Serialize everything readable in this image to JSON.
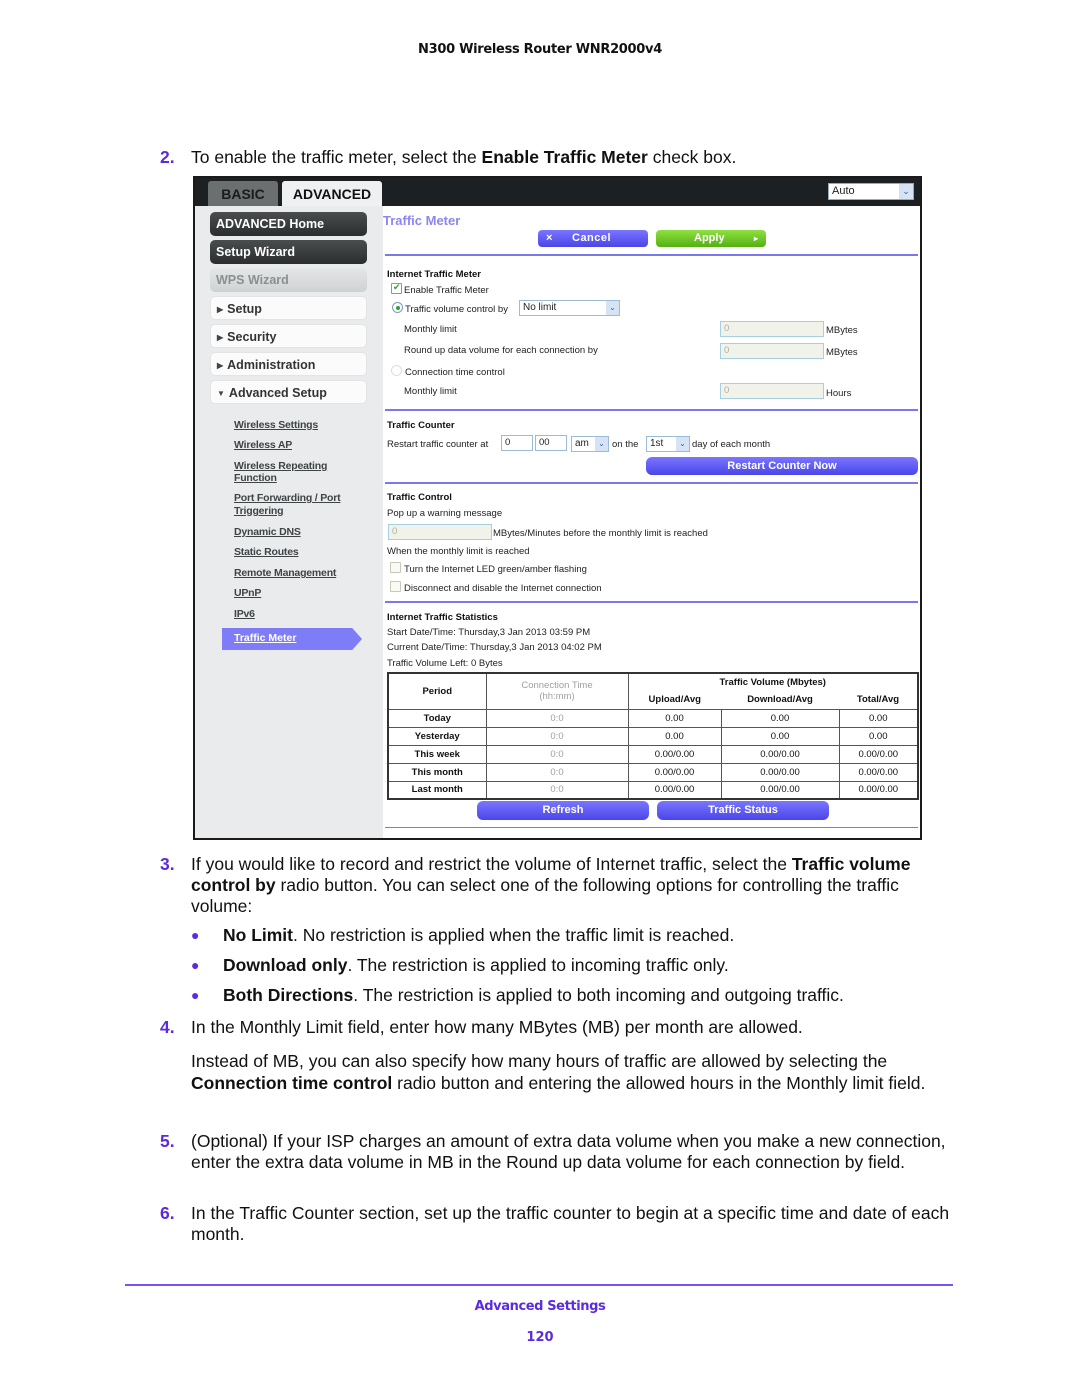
{
  "document": {
    "header": "N300 Wireless Router WNR2000v4",
    "footer_section": "Advanced Settings",
    "page_number": "120",
    "accent_color": "#5b2be0"
  },
  "steps": {
    "s2": {
      "num": "2.",
      "pre": "To enable the traffic meter, select the ",
      "bold": "Enable Traffic Meter",
      "post": " check box."
    },
    "s3": {
      "num": "3.",
      "pre": "If you would like to record and restrict the volume of Internet traffic, select the ",
      "bold": "Traffic volume control by",
      "post": " radio button. You can select one of the following options for controlling the traffic volume:"
    },
    "bullets": [
      {
        "bold": "No Limit",
        "text": ". No restriction is applied when the traffic limit is reached."
      },
      {
        "bold": "Download only",
        "text": ". The restriction is applied to incoming traffic only."
      },
      {
        "bold": "Both Directions",
        "text": ". The restriction is applied to both incoming and outgoing traffic."
      }
    ],
    "s4": {
      "num": "4.",
      "text": "In the Monthly Limit field, enter how many MBytes (MB) per month are allowed."
    },
    "s4_note": {
      "pre": "Instead of MB, you can also specify how many hours of traffic are allowed by selecting the ",
      "bold": "Connection time control",
      "post": " radio button and entering the allowed hours in the Monthly limit field."
    },
    "s5": {
      "num": "5.",
      "text": "(Optional) If your ISP charges an amount of extra data volume when you make a new connection, enter the extra data volume in MB in the Round up data volume for each connection by field."
    },
    "s6": {
      "num": "6.",
      "text": "In the Traffic Counter section, set up the traffic counter to begin at a specific time and date of each month."
    }
  },
  "router_ui": {
    "tabs": {
      "basic": "BASIC",
      "advanced": "ADVANCED"
    },
    "language_select": "Auto",
    "sidebar": {
      "advanced_home": "ADVANCED Home",
      "setup_wizard": "Setup Wizard",
      "wps_wizard": "WPS Wizard",
      "setup": "Setup",
      "security": "Security",
      "administration": "Administration",
      "advanced_setup": "Advanced Setup",
      "links": [
        "Wireless Settings",
        "Wireless AP",
        "Wireless Repeating",
        "Function",
        "Port Forwarding / Port",
        "Triggering",
        "Dynamic DNS",
        "Static Routes",
        "Remote Management",
        "UPnP",
        "IPv6"
      ],
      "active": "Traffic Meter"
    },
    "page_title": "Traffic Meter",
    "buttons": {
      "cancel": "Cancel",
      "cancel_icon": "×",
      "apply": "Apply",
      "apply_icon": "▸"
    },
    "internet_traffic_meter": {
      "title": "Internet Traffic Meter",
      "enable_label": "Enable Traffic Meter",
      "enable_checked": true,
      "volume_control_label": "Traffic volume control by",
      "volume_control_value": "No limit",
      "monthly_limit_label": "Monthly limit",
      "monthly_limit_value": "0",
      "monthly_limit_unit": "MBytes",
      "round_up_label": "Round up data volume for each connection by",
      "round_up_value": "0",
      "round_up_unit": "MBytes",
      "time_control_label": "Connection time control",
      "time_monthly_label": "Monthly limit",
      "time_monthly_value": "0",
      "time_monthly_unit": "Hours"
    },
    "traffic_counter": {
      "title": "Traffic Counter",
      "restart_label": "Restart traffic counter at",
      "hour": "0",
      "minute": "00",
      "ampm": "am",
      "on_the": "on the",
      "day": "1st",
      "day_suffix": "day of each month",
      "restart_button": "Restart Counter Now"
    },
    "traffic_control": {
      "title": "Traffic Control",
      "popup_label": "Pop up a warning message",
      "popup_value": "0",
      "popup_suffix": "MBytes/Minutes before the monthly limit is reached",
      "when_reached": "When the monthly limit is reached",
      "led_label": "Turn the Internet LED green/amber flashing",
      "disconnect_label": "Disconnect and disable the Internet connection"
    },
    "statistics": {
      "title": "Internet Traffic Statistics",
      "start": "Start Date/Time: Thursday,3 Jan 2013 03:59 PM",
      "current": "Current Date/Time: Thursday,3 Jan 2013 04:02 PM",
      "volume_left": "Traffic Volume Left: 0 Bytes",
      "headers": {
        "period": "Period",
        "conn_time": "Connection Time",
        "conn_time_unit": "(hh:mm)",
        "traffic_volume": "Traffic Volume (Mbytes)",
        "upload": "Upload/Avg",
        "download": "Download/Avg",
        "total": "Total/Avg"
      },
      "rows": [
        {
          "period": "Today",
          "conn": "0:0",
          "upload": "0.00",
          "download": "0.00",
          "total": "0.00"
        },
        {
          "period": "Yesterday",
          "conn": "0:0",
          "upload": "0.00",
          "download": "0.00",
          "total": "0.00"
        },
        {
          "period": "This week",
          "conn": "0:0",
          "upload": "0.00/0.00",
          "download": "0.00/0.00",
          "total": "0.00/0.00"
        },
        {
          "period": "This month",
          "conn": "0:0",
          "upload": "0.00/0.00",
          "download": "0.00/0.00",
          "total": "0.00/0.00"
        },
        {
          "period": "Last month",
          "conn": "0:0",
          "upload": "0.00/0.00",
          "download": "0.00/0.00",
          "total": "0.00/0.00"
        }
      ],
      "refresh_button": "Refresh",
      "status_button": "Traffic Status"
    }
  }
}
